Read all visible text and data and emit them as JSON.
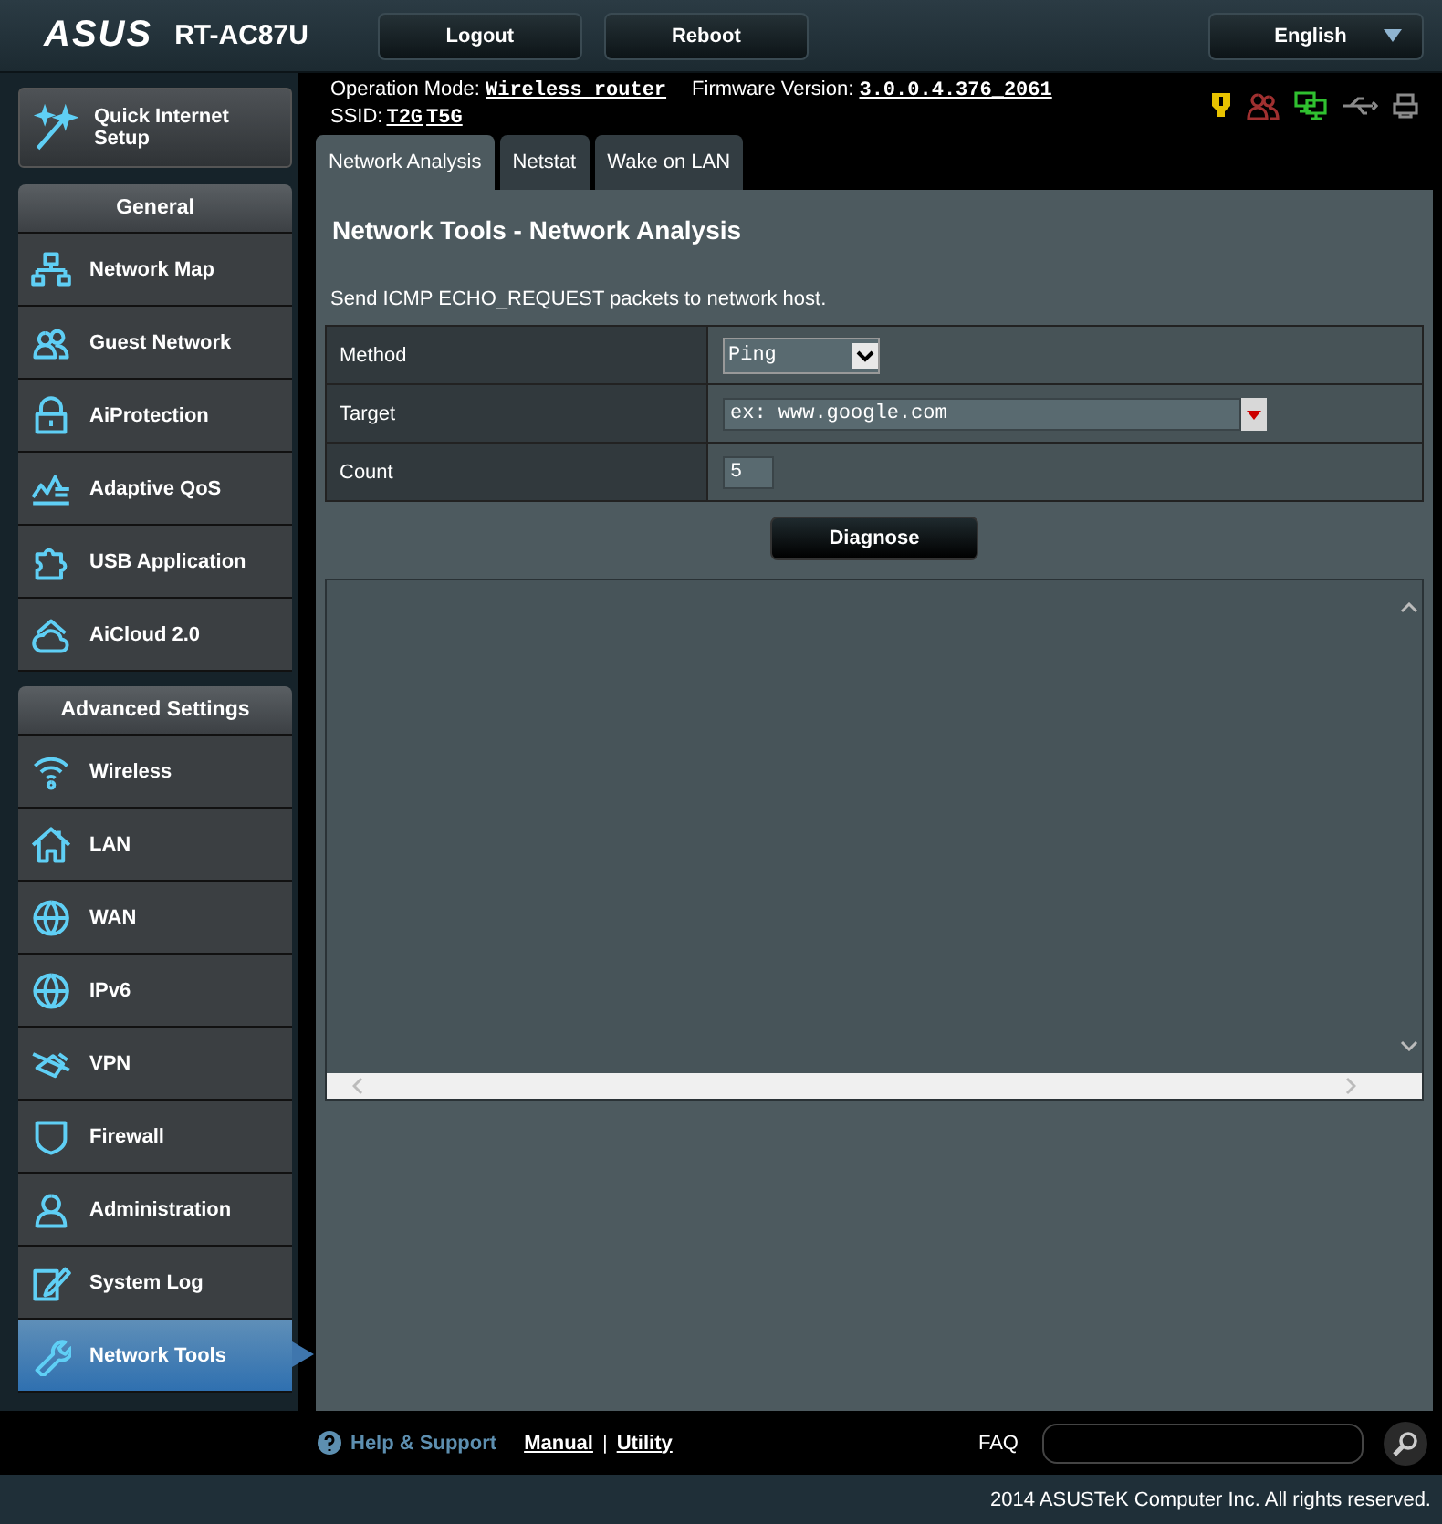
{
  "header": {
    "logo": "ASUS",
    "model": "RT-AC87U",
    "buttons": [
      "Logout",
      "Reboot"
    ],
    "language": "English"
  },
  "info": {
    "mode_label": "Operation Mode:",
    "mode": "Wireless router",
    "firmware_label": "Firmware Version:",
    "firmware": "3.0.0.4.376_2061",
    "ssid_label": "SSID:",
    "ssids": [
      "T2G",
      "T5G"
    ]
  },
  "sidebar": {
    "quick_setup": "Quick Internet Setup",
    "sections": [
      {
        "title": "General",
        "items": [
          {
            "label": "Network Map",
            "selected": false
          },
          {
            "label": "Guest Network",
            "selected": false
          },
          {
            "label": "AiProtection",
            "selected": false
          },
          {
            "label": "Adaptive QoS",
            "selected": false
          },
          {
            "label": "USB Application",
            "selected": false
          },
          {
            "label": "AiCloud 2.0",
            "selected": false
          }
        ]
      },
      {
        "title": "Advanced Settings",
        "items": [
          {
            "label": "Wireless",
            "selected": false
          },
          {
            "label": "LAN",
            "selected": false
          },
          {
            "label": "WAN",
            "selected": false
          },
          {
            "label": "IPv6",
            "selected": false
          },
          {
            "label": "VPN",
            "selected": false
          },
          {
            "label": "Firewall",
            "selected": false
          },
          {
            "label": "Administration",
            "selected": false
          },
          {
            "label": "System Log",
            "selected": false
          },
          {
            "label": "Network Tools",
            "selected": true
          }
        ]
      }
    ]
  },
  "tabs": [
    {
      "label": "Network Analysis",
      "selected": true
    },
    {
      "label": "Netstat",
      "selected": false
    },
    {
      "label": "Wake on LAN",
      "selected": false
    }
  ],
  "panel": {
    "title": "Network Tools - Network Analysis",
    "description": "Send ICMP ECHO_REQUEST packets to network host.",
    "rows": [
      {
        "label": "Method",
        "kind": "select",
        "value": "Ping"
      },
      {
        "label": "Target",
        "kind": "combo",
        "placeholder": "ex: www.google.com"
      },
      {
        "label": "Count",
        "kind": "text",
        "value": "5"
      }
    ],
    "button": "Diagnose"
  },
  "footer": {
    "help": "Help & Support",
    "links": [
      "Manual",
      "Utility"
    ],
    "separator": "|",
    "faq": "FAQ",
    "copyright": "2014 ASUSTeK Computer Inc. All rights reserved."
  }
}
